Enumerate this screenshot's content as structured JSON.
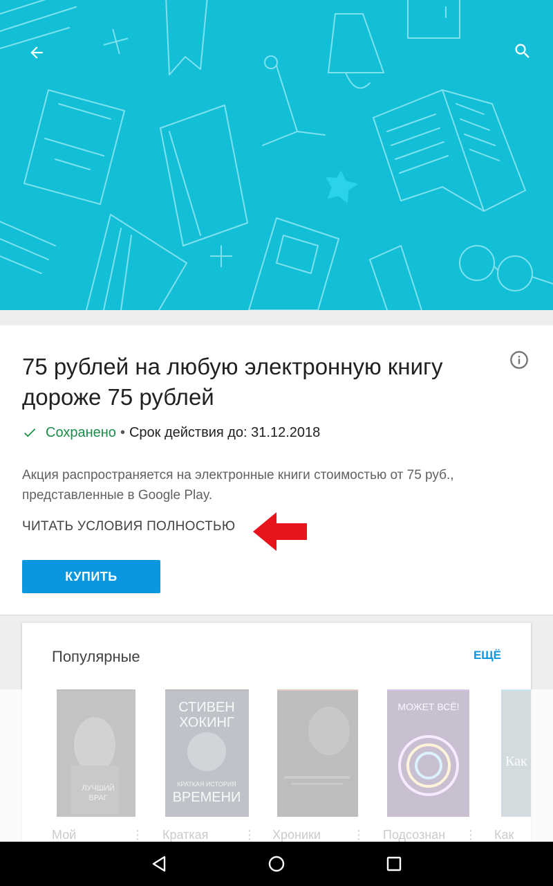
{
  "hero": {
    "back_icon": "arrow-back-icon",
    "search_icon": "search-icon",
    "background_color": "#13bfd6"
  },
  "offer": {
    "title": "75 рублей на любую электронную книгу дороже 75 рублей",
    "info_icon": "info-icon",
    "saved_label": "Сохранено",
    "separator": "•",
    "valid_until": "Срок действия до: 31.12.2018",
    "description": "Акция распространяется на электронные книги стоимостью от 75 руб., представленные в Google Play.",
    "terms_link": "ЧИТАТЬ УСЛОВИЯ ПОЛНОСТЬЮ",
    "buy_label": "КУПИТЬ",
    "accent_color": "#0b96e0",
    "saved_color": "#1a8e48"
  },
  "popular": {
    "title": "Популярные",
    "more_label": "ЕЩЁ",
    "books": [
      {
        "title": "Мой",
        "cover_text": [
          "ЛУЧШИЙ",
          "ВРАГ"
        ]
      },
      {
        "title": "Краткая",
        "cover_text": [
          "СТИВЕН",
          "ХОКИНГ",
          "КРАТКАЯ ИСТОРИЯ",
          "ВРЕМЕНИ"
        ]
      },
      {
        "title": "Хроники",
        "cover_text": []
      },
      {
        "title": "Подсознан",
        "cover_text": [
          "МОЖЕТ ВСЁ!"
        ]
      },
      {
        "title": "Как",
        "cover_text": [
          "Как"
        ]
      }
    ]
  },
  "annotation": {
    "arrow_color": "#e8141c"
  },
  "navbar": {
    "back_icon": "nav-back-icon",
    "home_icon": "nav-home-icon",
    "recents_icon": "nav-recents-icon"
  }
}
